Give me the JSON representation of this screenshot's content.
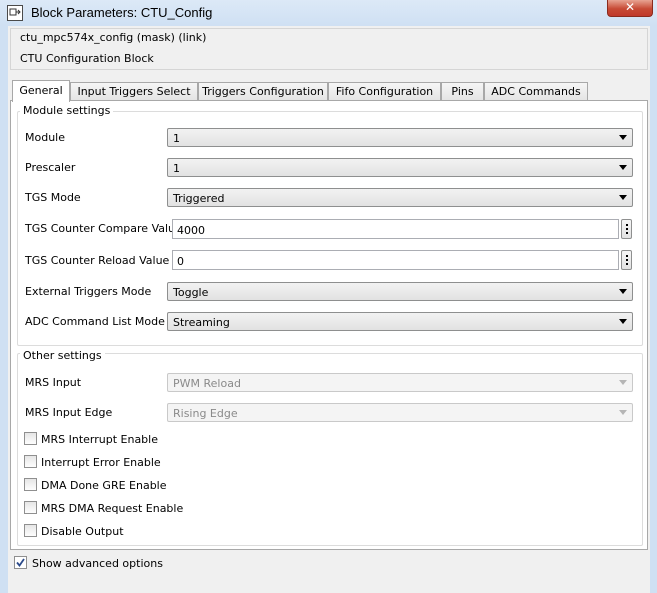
{
  "window": {
    "title": "Block Parameters: CTU_Config",
    "close_glyph": "✕",
    "icon": "simulink-block-icon"
  },
  "header": {
    "block_name": "ctu_mpc574x_config (mask) (link)",
    "description": "CTU Configuration Block"
  },
  "tabs": [
    "General",
    "Input Triggers Select",
    "Triggers Configuration",
    "Fifo Configuration",
    "Pins",
    "ADC Commands"
  ],
  "active_tab": "General",
  "module_settings": {
    "title": "Module settings",
    "module": {
      "label": "Module",
      "value": "1"
    },
    "prescaler": {
      "label": "Prescaler",
      "value": "1"
    },
    "tgs_mode": {
      "label": "TGS Mode",
      "value": "Triggered"
    },
    "tgs_counter_compare": {
      "label": "TGS Counter Compare Value",
      "value": "4000"
    },
    "tgs_counter_reload": {
      "label": "TGS Counter Reload Value",
      "value": "0"
    },
    "external_triggers_mode": {
      "label": "External Triggers Mode",
      "value": "Toggle"
    },
    "adc_command_list_mode": {
      "label": "ADC Command List Mode",
      "value": "Streaming"
    }
  },
  "other_settings": {
    "title": "Other settings",
    "mrs_input": {
      "label": "MRS Input",
      "value": "PWM Reload"
    },
    "mrs_input_edge": {
      "label": "MRS Input Edge",
      "value": "Rising Edge"
    },
    "checkboxes": [
      {
        "label": "MRS Interrupt Enable",
        "checked": false
      },
      {
        "label": "Interrupt Error Enable",
        "checked": false
      },
      {
        "label": "DMA Done GRE Enable",
        "checked": false
      },
      {
        "label": "MRS DMA Request Enable",
        "checked": false
      },
      {
        "label": "Disable Output",
        "checked": false
      }
    ]
  },
  "advanced": {
    "label": "Show advanced options",
    "checked": true
  },
  "colors": {
    "title_bar": "#cfe0f3",
    "close_button": "#c74a35",
    "panel_bg": "#ffffff"
  }
}
